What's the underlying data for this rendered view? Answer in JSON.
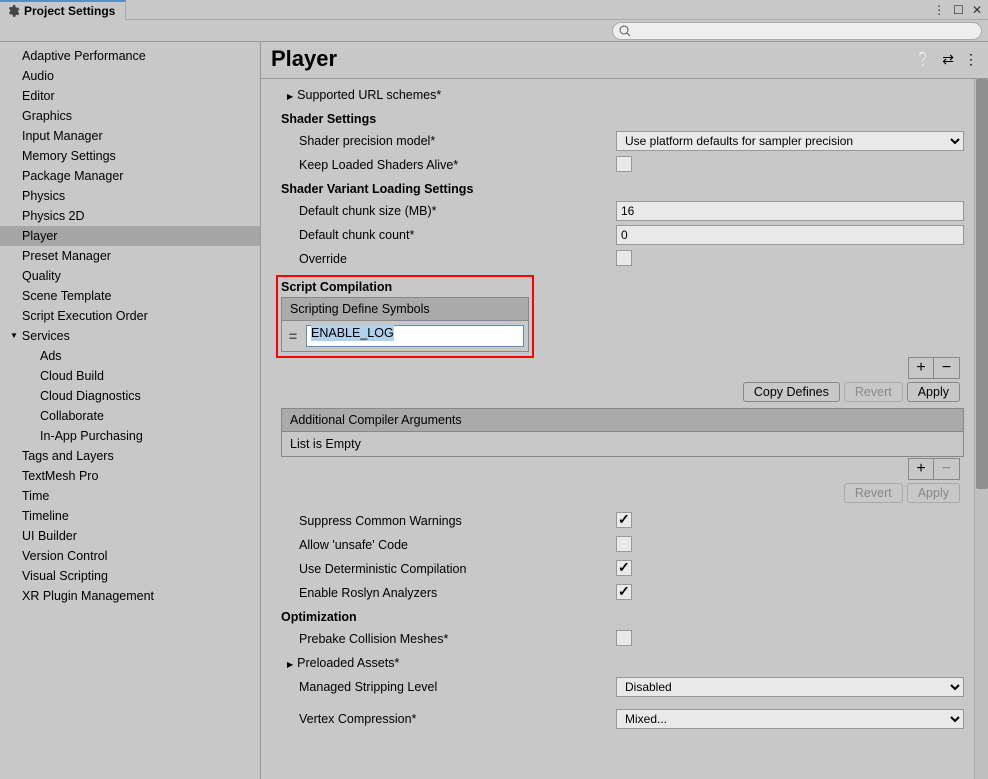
{
  "window": {
    "title": "Project Settings"
  },
  "search": {
    "placeholder": ""
  },
  "sidebar": {
    "items": [
      {
        "label": "Adaptive Performance"
      },
      {
        "label": "Audio"
      },
      {
        "label": "Editor"
      },
      {
        "label": "Graphics"
      },
      {
        "label": "Input Manager"
      },
      {
        "label": "Memory Settings"
      },
      {
        "label": "Package Manager"
      },
      {
        "label": "Physics"
      },
      {
        "label": "Physics 2D"
      },
      {
        "label": "Player",
        "selected": true
      },
      {
        "label": "Preset Manager"
      },
      {
        "label": "Quality"
      },
      {
        "label": "Scene Template"
      },
      {
        "label": "Script Execution Order"
      },
      {
        "label": "Services",
        "expandable": true
      },
      {
        "label": "Ads",
        "indent": true
      },
      {
        "label": "Cloud Build",
        "indent": true
      },
      {
        "label": "Cloud Diagnostics",
        "indent": true
      },
      {
        "label": "Collaborate",
        "indent": true
      },
      {
        "label": "In-App Purchasing",
        "indent": true
      },
      {
        "label": "Tags and Layers"
      },
      {
        "label": "TextMesh Pro"
      },
      {
        "label": "Time"
      },
      {
        "label": "Timeline"
      },
      {
        "label": "UI Builder"
      },
      {
        "label": "Version Control"
      },
      {
        "label": "Visual Scripting"
      },
      {
        "label": "XR Plugin Management"
      }
    ]
  },
  "content": {
    "title": "Player",
    "urlSchemes": "Supported URL schemes*",
    "shaderSettings": {
      "title": "Shader Settings",
      "precision": {
        "label": "Shader precision model*",
        "value": "Use platform defaults for sampler precision"
      },
      "keepLoaded": {
        "label": "Keep Loaded Shaders Alive*",
        "checked": false
      }
    },
    "variantLoading": {
      "title": "Shader Variant Loading Settings",
      "chunkSize": {
        "label": "Default chunk size (MB)*",
        "value": "16"
      },
      "chunkCount": {
        "label": "Default chunk count*",
        "value": "0"
      },
      "override": {
        "label": "Override",
        "checked": false
      }
    },
    "scriptCompilation": {
      "title": "Script Compilation",
      "symbolsHeader": "Scripting Define Symbols",
      "defineValue": "ENABLE_LOG",
      "copyDefines": "Copy Defines",
      "revert": "Revert",
      "apply": "Apply",
      "argsHeader": "Additional Compiler Arguments",
      "argsEmpty": "List is Empty",
      "suppressWarnings": {
        "label": "Suppress Common Warnings",
        "checked": true
      },
      "allowUnsafe": {
        "label": "Allow 'unsafe' Code",
        "checked": false
      },
      "deterministic": {
        "label": "Use Deterministic Compilation",
        "checked": true
      },
      "roslyn": {
        "label": "Enable Roslyn Analyzers",
        "checked": true
      }
    },
    "optimization": {
      "title": "Optimization",
      "prebake": {
        "label": "Prebake Collision Meshes*",
        "checked": false
      },
      "preloaded": "Preloaded Assets*",
      "stripping": {
        "label": "Managed Stripping Level",
        "value": "Disabled"
      },
      "vertexCompression": {
        "label": "Vertex Compression*",
        "value": "Mixed..."
      }
    }
  }
}
